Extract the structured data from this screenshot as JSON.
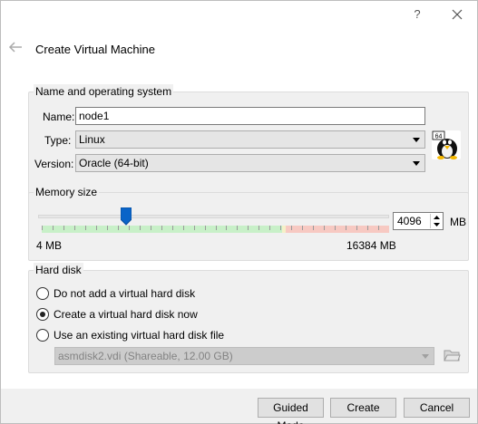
{
  "titlebar": {
    "help_label": "?",
    "close_icon": "close-icon"
  },
  "wizard": {
    "title": "Create Virtual Machine",
    "back_icon": "back-arrow-icon"
  },
  "name_os": {
    "group_title": "Name and operating system",
    "name_label": "Name:",
    "name_value": "node1",
    "type_label": "Type:",
    "type_value": "Linux",
    "version_label": "Version:",
    "version_value": "Oracle (64-bit)",
    "os_badge": "64"
  },
  "memory": {
    "group_title": "Memory size",
    "value": "4096",
    "unit": "MB",
    "min_label": "4 MB",
    "max_label": "16384 MB",
    "slider_fraction": 0.25
  },
  "hard_disk": {
    "group_title": "Hard disk",
    "options": [
      {
        "label": "Do not add a virtual hard disk",
        "checked": false
      },
      {
        "label": "Create a virtual hard disk now",
        "checked": true
      },
      {
        "label": "Use an existing virtual hard disk file",
        "checked": false
      }
    ],
    "existing_file": "asmdisk2.vdi (Shareable, 12.00 GB)"
  },
  "buttons": {
    "guided": "Guided Mode",
    "create": "Create",
    "cancel": "Cancel"
  },
  "colors": {
    "scale_green": "#c8f0c8",
    "scale_yellow": "#f5f0c8",
    "scale_red": "#f7c9c2",
    "slider_handle": "#0a64c8"
  }
}
